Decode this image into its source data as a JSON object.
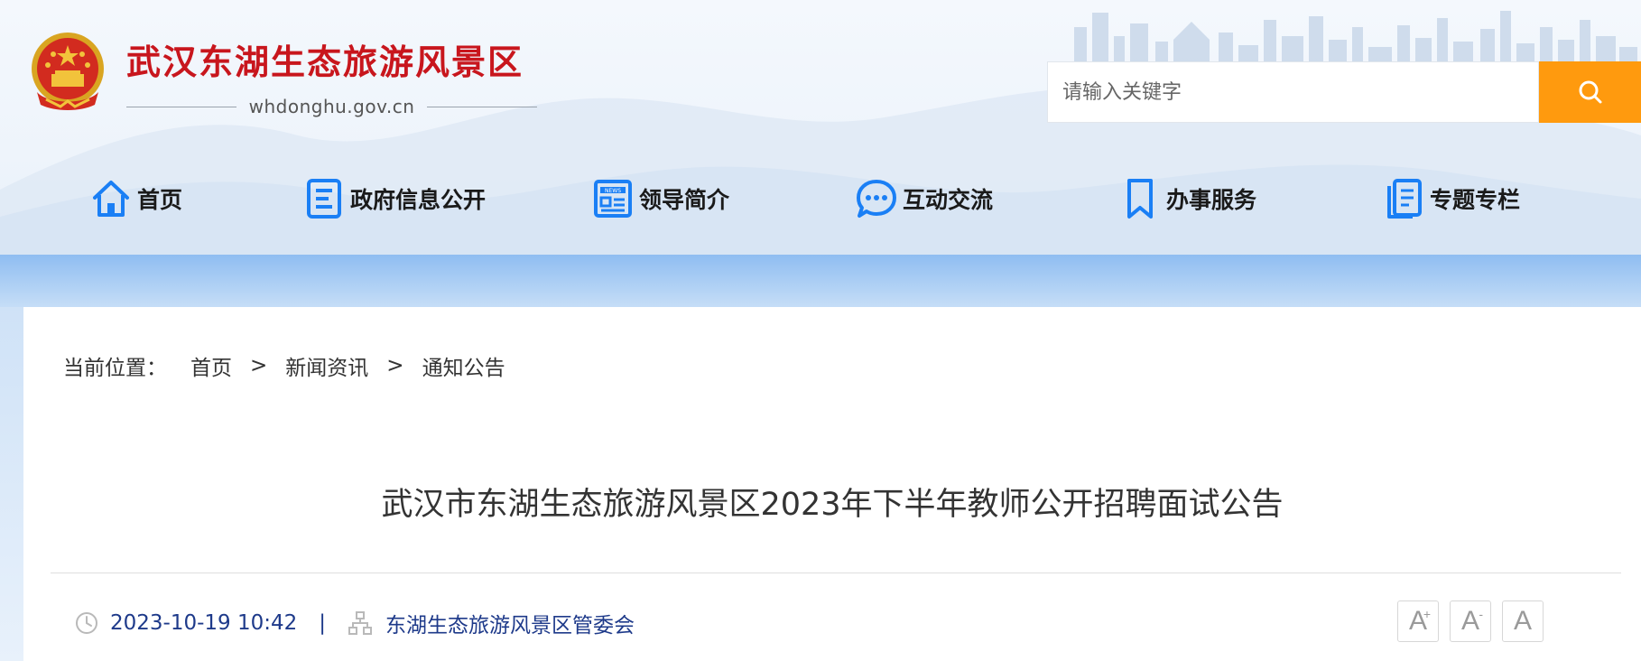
{
  "site": {
    "name": "武汉东湖生态旅游风景区",
    "domain": "whdonghu.gov.cn"
  },
  "search": {
    "placeholder": "请输入关键字",
    "value": ""
  },
  "nav": [
    {
      "label": "首页",
      "icon": "home-icon"
    },
    {
      "label": "政府信息公开",
      "icon": "document-icon"
    },
    {
      "label": "领导简介",
      "icon": "news-icon"
    },
    {
      "label": "互动交流",
      "icon": "chat-icon"
    },
    {
      "label": "办事服务",
      "icon": "bookmark-icon"
    },
    {
      "label": "专题专栏",
      "icon": "pages-icon"
    }
  ],
  "breadcrumb": {
    "prefix": "当前位置：",
    "items": [
      "首页",
      "新闻资讯",
      "通知公告"
    ],
    "separator": ">"
  },
  "article": {
    "title": "武汉市东湖生态旅游风景区2023年下半年教师公开招聘面试公告",
    "date": "2023-10-19 10:42",
    "separator": "|",
    "source": "东湖生态旅游风景区管委会"
  },
  "font_tools": {
    "increase_label": "A",
    "increase_sup": "+",
    "decrease_label": "A",
    "decrease_sup": "-",
    "reset_label": "A"
  },
  "colors": {
    "brand_red": "#c8161d",
    "search_orange": "#ff9a0e",
    "nav_icon_blue": "#1a7ff5",
    "meta_blue": "#1e3a8a"
  }
}
